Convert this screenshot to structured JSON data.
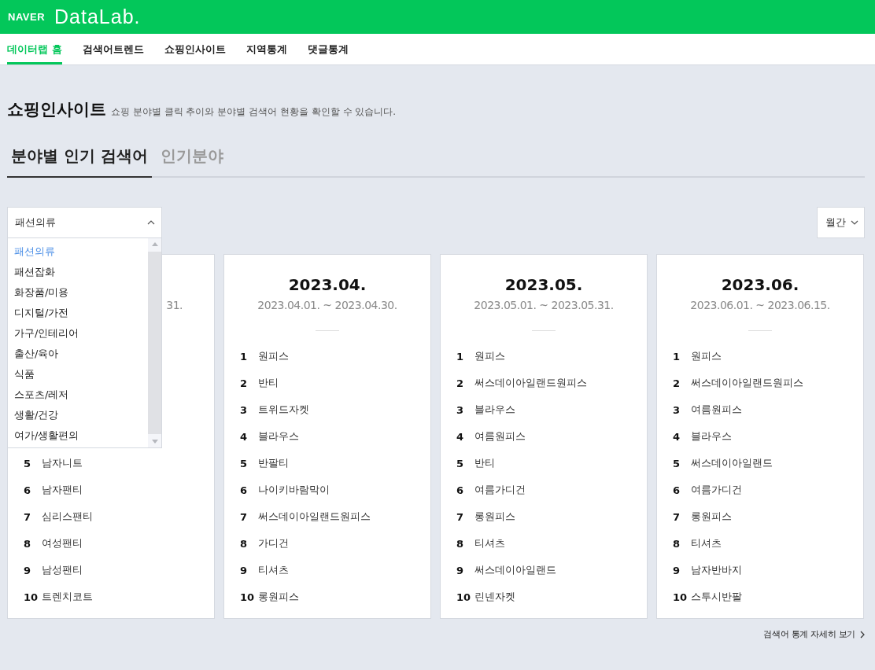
{
  "header": {
    "brand": "NAVER",
    "product": "DataLab."
  },
  "nav": [
    {
      "label": "데이터랩 홈",
      "selected": true
    },
    {
      "label": "검색어트렌드",
      "selected": false
    },
    {
      "label": "쇼핑인사이트",
      "selected": false
    },
    {
      "label": "지역통계",
      "selected": false
    },
    {
      "label": "댓글통계",
      "selected": false
    }
  ],
  "page": {
    "title": "쇼핑인사이트",
    "description": "쇼핑 분야별 클릭 추이와 분야별 검색어 현황을 확인할 수 있습니다."
  },
  "tabs": [
    {
      "label": "분야별 인기 검색어",
      "selected": true
    },
    {
      "label": "인기분야",
      "selected": false
    }
  ],
  "category_select": {
    "value": "패션의류",
    "expanded": true,
    "options": [
      {
        "label": "패션의류",
        "selected": true
      },
      {
        "label": "패션잡화",
        "selected": false
      },
      {
        "label": "화장품/미용",
        "selected": false
      },
      {
        "label": "디지털/가전",
        "selected": false
      },
      {
        "label": "가구/인테리어",
        "selected": false
      },
      {
        "label": "출산/육아",
        "selected": false
      },
      {
        "label": "식품",
        "selected": false
      },
      {
        "label": "스포츠/레저",
        "selected": false
      },
      {
        "label": "생활/건강",
        "selected": false
      },
      {
        "label": "여가/생활편의",
        "selected": false
      }
    ]
  },
  "period_select": {
    "value": "월간"
  },
  "cards": [
    {
      "range": "31.",
      "rows": [
        {
          "rank": "5",
          "term": "남자니트"
        },
        {
          "rank": "6",
          "term": "남자팬티"
        },
        {
          "rank": "7",
          "term": "심리스팬티"
        },
        {
          "rank": "8",
          "term": "여성팬티"
        },
        {
          "rank": "9",
          "term": "남성팬티"
        },
        {
          "rank": "10",
          "term": "트렌치코트"
        }
      ]
    },
    {
      "title": "2023.04.",
      "range": "2023.04.01. ~ 2023.04.30.",
      "rows": [
        {
          "rank": "1",
          "term": "원피스"
        },
        {
          "rank": "2",
          "term": "반티"
        },
        {
          "rank": "3",
          "term": "트위드자켓"
        },
        {
          "rank": "4",
          "term": "블라우스"
        },
        {
          "rank": "5",
          "term": "반팔티"
        },
        {
          "rank": "6",
          "term": "나이키바람막이"
        },
        {
          "rank": "7",
          "term": "써스데이아일랜드원피스"
        },
        {
          "rank": "8",
          "term": "가디건"
        },
        {
          "rank": "9",
          "term": "티셔츠"
        },
        {
          "rank": "10",
          "term": "롱원피스"
        }
      ]
    },
    {
      "title": "2023.05.",
      "range": "2023.05.01. ~ 2023.05.31.",
      "rows": [
        {
          "rank": "1",
          "term": "원피스"
        },
        {
          "rank": "2",
          "term": "써스데이아일랜드원피스"
        },
        {
          "rank": "3",
          "term": "블라우스"
        },
        {
          "rank": "4",
          "term": "여름원피스"
        },
        {
          "rank": "5",
          "term": "반티"
        },
        {
          "rank": "6",
          "term": "여름가디건"
        },
        {
          "rank": "7",
          "term": "롱원피스"
        },
        {
          "rank": "8",
          "term": "티셔츠"
        },
        {
          "rank": "9",
          "term": "써스데이아일랜드"
        },
        {
          "rank": "10",
          "term": "린넨자켓"
        }
      ]
    },
    {
      "title": "2023.06.",
      "range": "2023.06.01. ~ 2023.06.15.",
      "rows": [
        {
          "rank": "1",
          "term": "원피스"
        },
        {
          "rank": "2",
          "term": "써스데이아일랜드원피스"
        },
        {
          "rank": "3",
          "term": "여름원피스"
        },
        {
          "rank": "4",
          "term": "블라우스"
        },
        {
          "rank": "5",
          "term": "써스데이아일랜드"
        },
        {
          "rank": "6",
          "term": "여름가디건"
        },
        {
          "rank": "7",
          "term": "롱원피스"
        },
        {
          "rank": "8",
          "term": "티셔츠"
        },
        {
          "rank": "9",
          "term": "남자반바지"
        },
        {
          "rank": "10",
          "term": "스투시반팔"
        }
      ]
    }
  ],
  "more_link": "검색어 통계 자세히 보기"
}
